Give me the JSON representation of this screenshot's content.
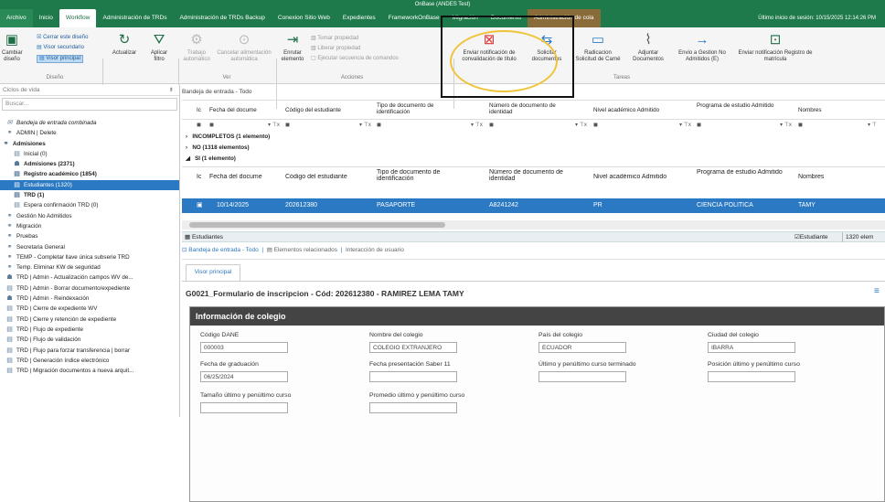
{
  "window_title": "OnBase (ANDES Test)",
  "tabs": [
    "Archivo",
    "Inicio",
    "Workflow",
    "Administración de TRDs",
    "Administración de TRDs Backup",
    "Conexion Sitio Web",
    "Expedientes",
    "FrameworkOnBase",
    "Migración",
    "Documento",
    "Administración de cola"
  ],
  "last_login": "Último inicio de sesión: 10/15/2025 12:14:26 PM",
  "ribbon": {
    "cambiar_diseno": "Cambiar diseño",
    "cerrar_diseno": "Cerrar este diseño",
    "visor_secundario": "Visor secundario",
    "visor_principal": "Visor principal",
    "diseno_group": "Diseño",
    "actualizar": "Actualizar",
    "aplicar_filtro": "Aplicar filtro",
    "trabajo_automatico": "Trabajo automático",
    "cancelar_alimentacion": "Cancelar alimentación automática",
    "ver_group": "Ver",
    "enrutar_elemento": "Enrutar elemento",
    "tomar_propiedad": "Tomar propiedad",
    "liberar_propiedad": "Liberar propiedad",
    "ejecutar_secuencia": "Ejecutar secuencia de comandos",
    "acciones_group": "Acciones",
    "enviar_notificacion": "Enviar notificación de convalidación de título",
    "solicitar_documentos": "Solicitar documentos",
    "radicacion_carne": "Radicacion Solicitud de Carné",
    "adjuntar_documentos": "Adjuntar Documentos",
    "envio_gestion": "Envio a Gestion No Admitidos (E)",
    "enviar_registro": "Enviar notificación Registro de matrícula",
    "tareas_group": "Tareas"
  },
  "left": {
    "header": "Ciclos de vida",
    "search_placeholder": "Buscar...",
    "items": [
      {
        "label": "Bandeja de entrada combinada",
        "icon": "inbox-icon",
        "indent": 6,
        "style": "italic"
      },
      {
        "label": "ADMIN | Delete",
        "icon": "workflow-icon",
        "indent": 6,
        "style": ""
      },
      {
        "label": "Admisiones",
        "icon": "workflow-icon",
        "indent": 2,
        "style": "bold"
      },
      {
        "label": "Inicial (0)",
        "icon": "queue-icon",
        "indent": 14,
        "style": ""
      },
      {
        "label": "Admisiones (2371)",
        "icon": "users-icon",
        "indent": 14,
        "style": "bold"
      },
      {
        "label": "Registro académico (1854)",
        "icon": "queue-icon",
        "indent": 14,
        "style": "bold"
      },
      {
        "label": "Estudiantes (1320)",
        "icon": "queue-icon",
        "indent": 14,
        "style": "sel"
      },
      {
        "label": "TRD (1)",
        "icon": "queue-icon",
        "indent": 14,
        "style": "bold"
      },
      {
        "label": "Espera confirmación TRD (0)",
        "icon": "queue-icon",
        "indent": 14,
        "style": ""
      },
      {
        "label": "Gestión No Admitidos",
        "icon": "workflow-icon",
        "indent": 6,
        "style": ""
      },
      {
        "label": "Migración",
        "icon": "workflow-icon",
        "indent": 6,
        "style": ""
      },
      {
        "label": "Pruebas",
        "icon": "workflow-icon",
        "indent": 6,
        "style": ""
      },
      {
        "label": "Secretaria General",
        "icon": "workflow-icon",
        "indent": 6,
        "style": ""
      },
      {
        "label": "TEMP - Completar llave única subserie TRD",
        "icon": "workflow-icon",
        "indent": 6,
        "style": ""
      },
      {
        "label": "Temp. Eliminar KW de seguridad",
        "icon": "workflow-icon",
        "indent": 6,
        "style": ""
      },
      {
        "label": "TRD | Admin - Actualización campos WV de...",
        "icon": "users-icon",
        "indent": 6,
        "style": ""
      },
      {
        "label": "TRD | Admin - Borrar documento/expediente",
        "icon": "queue-icon",
        "indent": 6,
        "style": ""
      },
      {
        "label": "TRD | Admin - Reindexación",
        "icon": "users-icon",
        "indent": 6,
        "style": ""
      },
      {
        "label": "TRD | Cierre de expediente WV",
        "icon": "queue-icon",
        "indent": 6,
        "style": ""
      },
      {
        "label": "TRD | Cierre y retención de expediente",
        "icon": "queue-icon",
        "indent": 6,
        "style": ""
      },
      {
        "label": "TRD | Flujo de expediente",
        "icon": "queue-icon",
        "indent": 6,
        "style": ""
      },
      {
        "label": "TRD | Flujo de validación",
        "icon": "queue-icon",
        "indent": 6,
        "style": ""
      },
      {
        "label": "TRD | Flujo para forzar transferencia | borrar",
        "icon": "queue-icon",
        "indent": 6,
        "style": ""
      },
      {
        "label": "TRD | Generación índice electrónico",
        "icon": "queue-icon",
        "indent": 6,
        "style": ""
      },
      {
        "label": "TRD | Migración documentos a nueva arquit...",
        "icon": "queue-icon",
        "indent": 6,
        "style": ""
      }
    ]
  },
  "inbox": {
    "title": "Bandeja de entrada - Todo",
    "columns": [
      "Ic",
      "Fecha del docume",
      "Código del estudiante",
      "Tipo de documento de identificación",
      "Número de documento de identidad",
      "Nivel académico Admitido",
      "Programa de estudio Admitido",
      "Nombres"
    ],
    "groups": [
      "INCOMPLETOS (1 elemento)",
      "NO (1318 elementos)",
      "SI (1 elemento)"
    ],
    "row": [
      "10/14/2025",
      "202612380",
      "PASAPORTE",
      "A8241242",
      "PR",
      "CIENCIA POLÍTICA",
      "TAMY"
    ]
  },
  "lower": {
    "panel_title": "Estudiantes",
    "tab_inbox": "Bandeja de entrada - Todo",
    "tab_related": "Elementos relacionados",
    "tab_interaction": "Interacción de usuario",
    "right_label1": "Estudiante",
    "right_label2": "1320 elem",
    "viewer_tab": "Visor principal",
    "form_title": "G0021_Formulario de inscripcion - Cód: 202612380 - RAMIREZ LEMA TAMY",
    "section_title": "Información de colegio",
    "fields": {
      "codigo_dane_label": "Código DANE",
      "codigo_dane": "000003",
      "nombre_colegio_label": "Nombre del colegio",
      "nombre_colegio": "COLEGIO EXTRANJERO",
      "pais_label": "País del colegio",
      "pais": "ECUADOR",
      "ciudad_label": "Ciudad del colegio",
      "ciudad": "IBARRA",
      "fecha_grad_label": "Fecha de graduación",
      "fecha_grad": "06/25/2024",
      "fecha_saber_label": "Fecha presentación Saber 11",
      "ultimo_curso_label": "Último y penúltimo curso terminado",
      "posicion_label": "Posición último y penúltimo curso",
      "tamano_label": "Tamaño último y penúltimo curso",
      "promedio_label": "Promedio último y penúltimo curso"
    }
  }
}
